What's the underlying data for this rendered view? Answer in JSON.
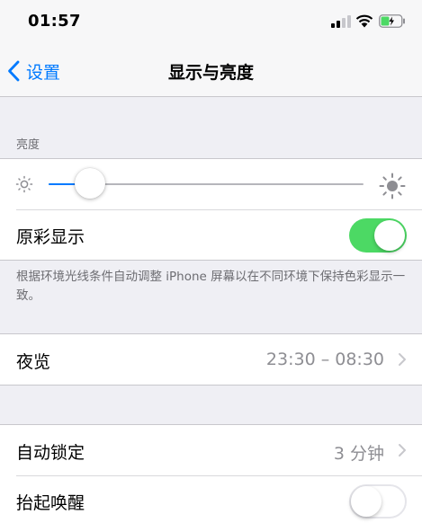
{
  "status_bar": {
    "time": "01:57"
  },
  "nav": {
    "back_label": "设置",
    "title": "显示与亮度"
  },
  "brightness": {
    "section_header": "亮度",
    "slider_level_fraction": 0.13
  },
  "true_tone": {
    "label": "原彩显示",
    "enabled": true,
    "footer": "根据环境光线条件自动调整 iPhone 屏幕以在不同环境下保持色彩显示一致。"
  },
  "night_shift": {
    "label": "夜览",
    "value": "23:30 – 08:30"
  },
  "auto_lock": {
    "label": "自动锁定",
    "value": "3 分钟"
  },
  "raise_to_wake": {
    "label": "抬起唤醒",
    "enabled": false
  },
  "colors": {
    "accent": "#007aff",
    "toggle_on": "#4cd964",
    "background": "#efeff4"
  }
}
